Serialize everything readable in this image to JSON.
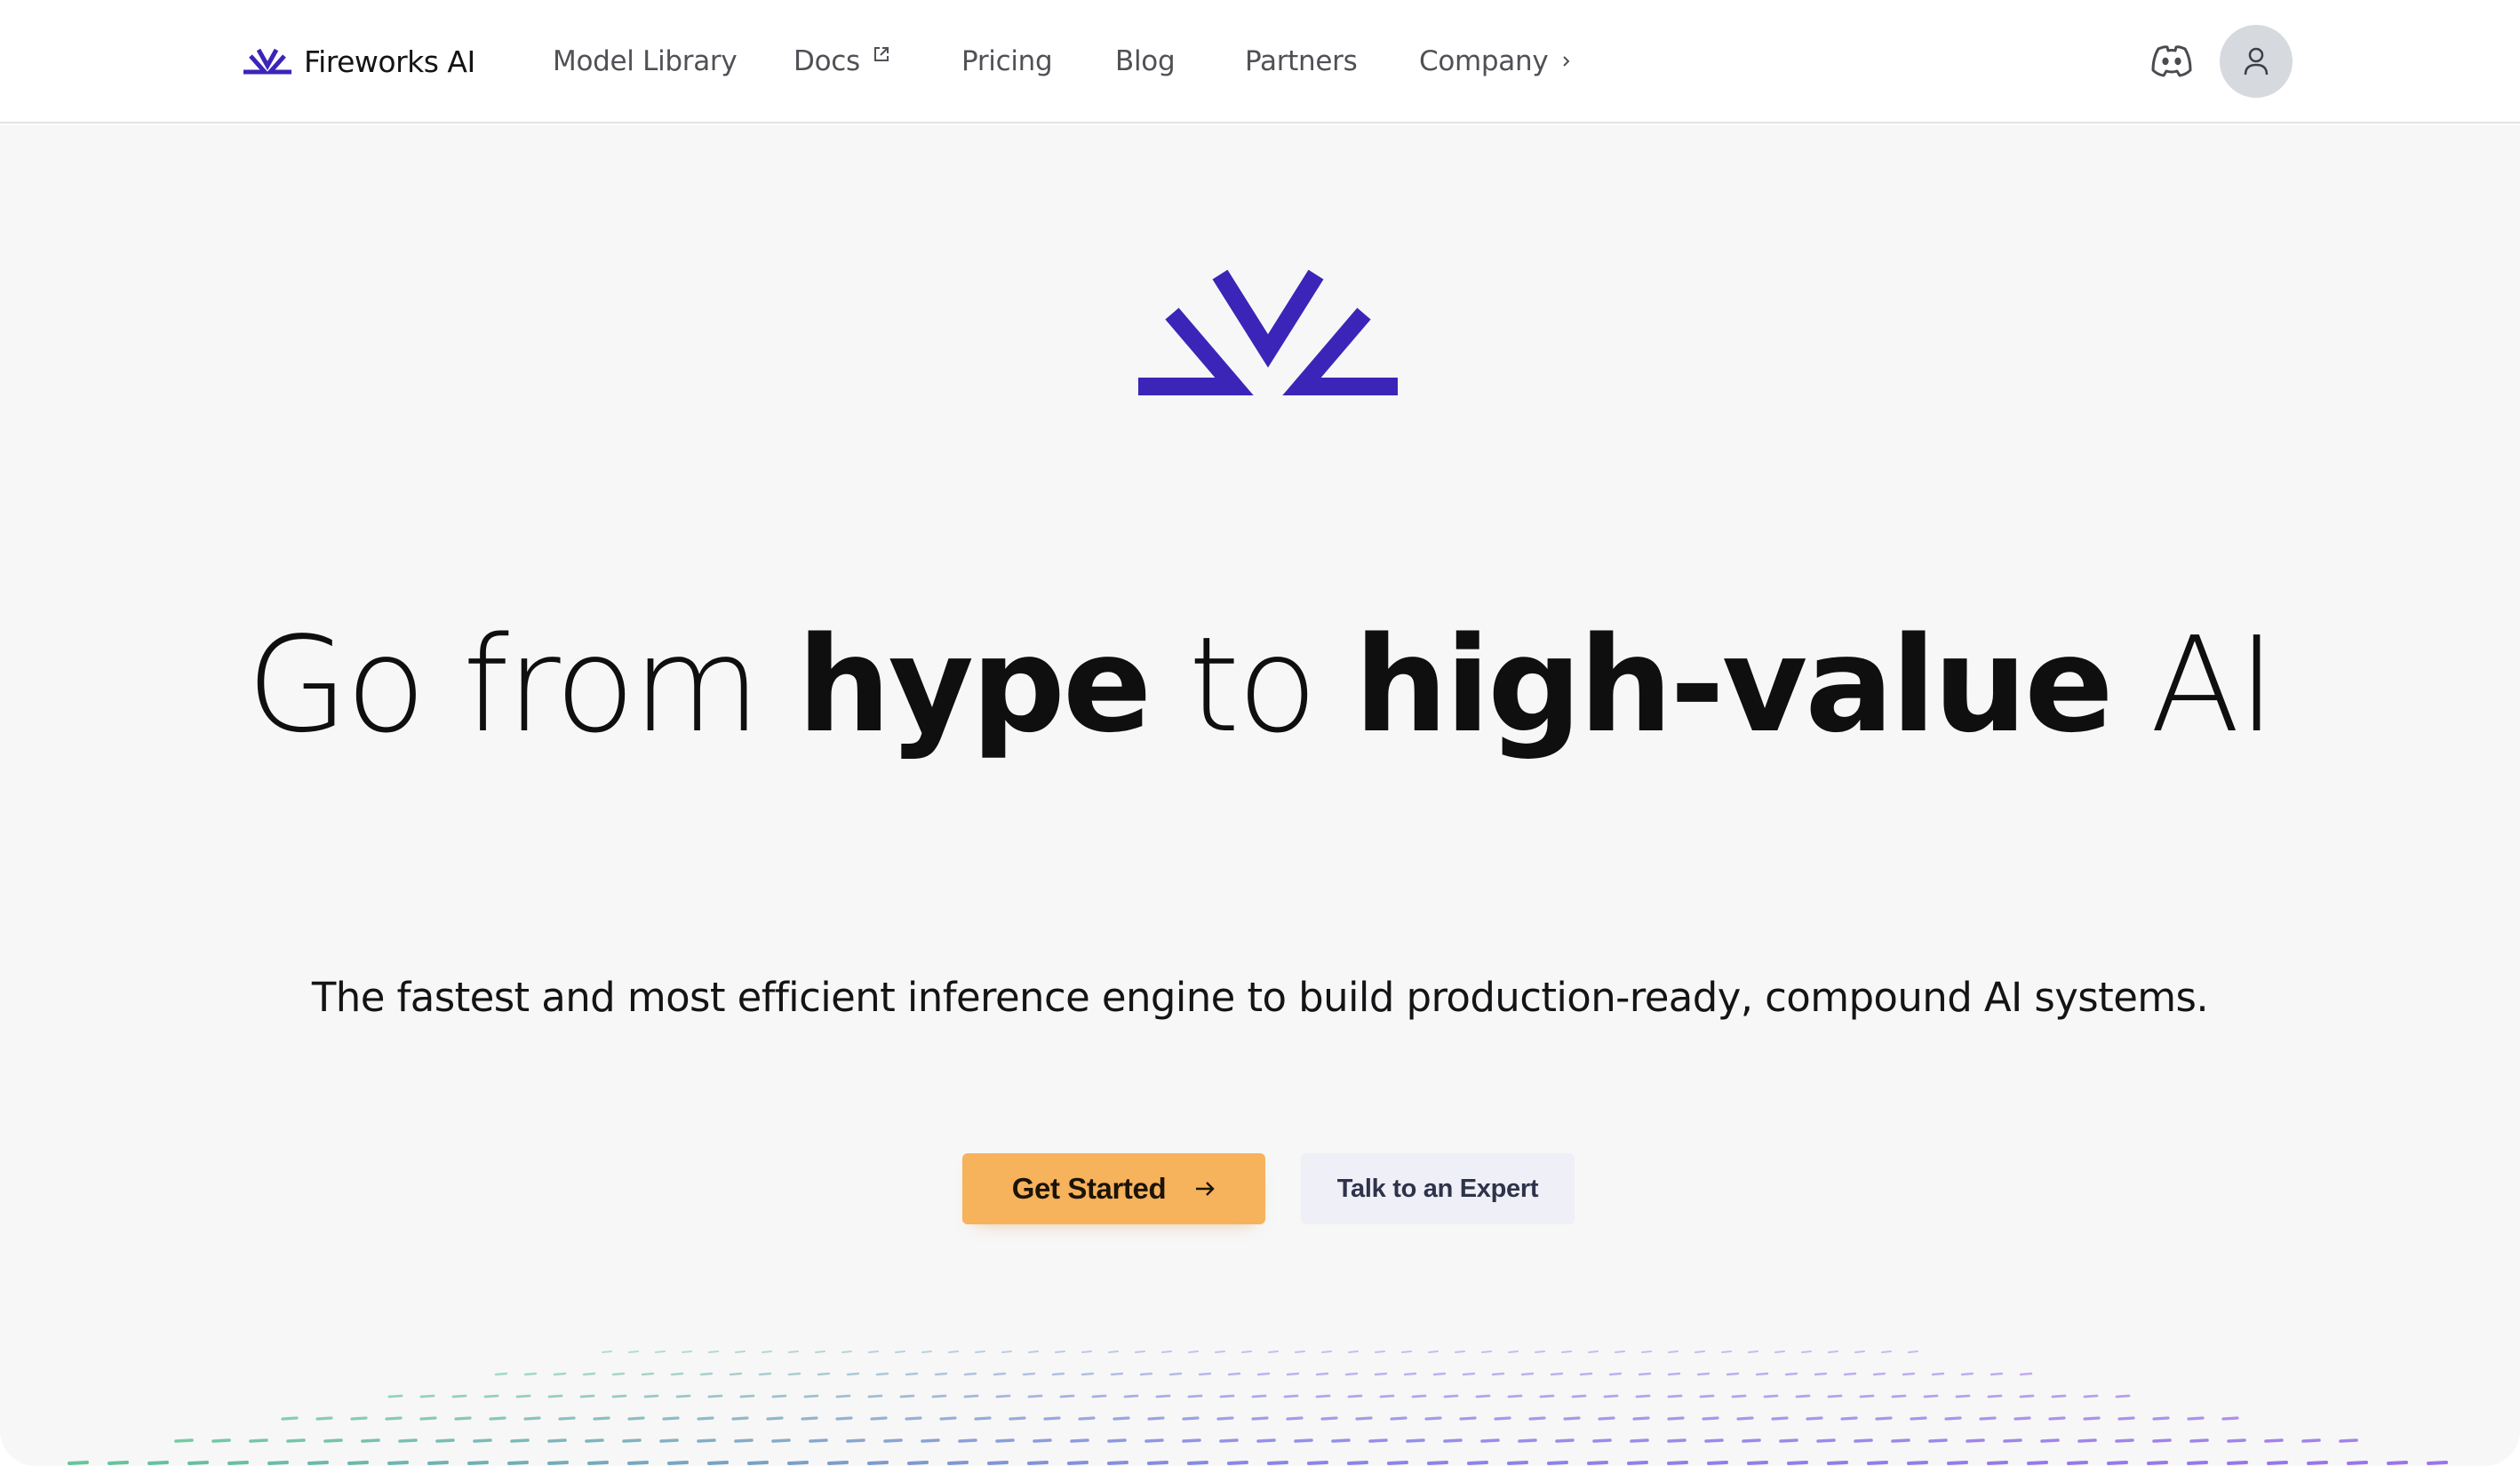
{
  "brand": {
    "name": "Fireworks AI",
    "logo_icon": "fireworks-logo-icon",
    "accent_color": "#3b25b8"
  },
  "nav": {
    "items": [
      {
        "label": "Model Library"
      },
      {
        "label": "Docs",
        "icon": "external-link-icon"
      },
      {
        "label": "Pricing"
      },
      {
        "label": "Blog"
      },
      {
        "label": "Partners"
      },
      {
        "label": "Company",
        "icon": "chevron-right-icon"
      }
    ],
    "discord_icon": "discord-icon",
    "avatar_icon": "user-icon"
  },
  "hero": {
    "headline": {
      "part1": "Go from ",
      "part2": "hype",
      "part3": " to ",
      "part4": "high-value",
      "part5": " AI"
    },
    "subheadline": "The fastest and most efficient inference engine to build production-ready, compound AI systems.",
    "cta_primary": {
      "label": "Get Started",
      "icon": "arrow-right-icon",
      "color": "#f7b25c"
    },
    "cta_secondary": {
      "label": "Talk to an Expert",
      "color": "#efeff8"
    }
  },
  "colors": {
    "background": "#f7f7f7",
    "nav_background": "#ffffff",
    "text": "#0f0f10",
    "nav_text": "#505056"
  }
}
